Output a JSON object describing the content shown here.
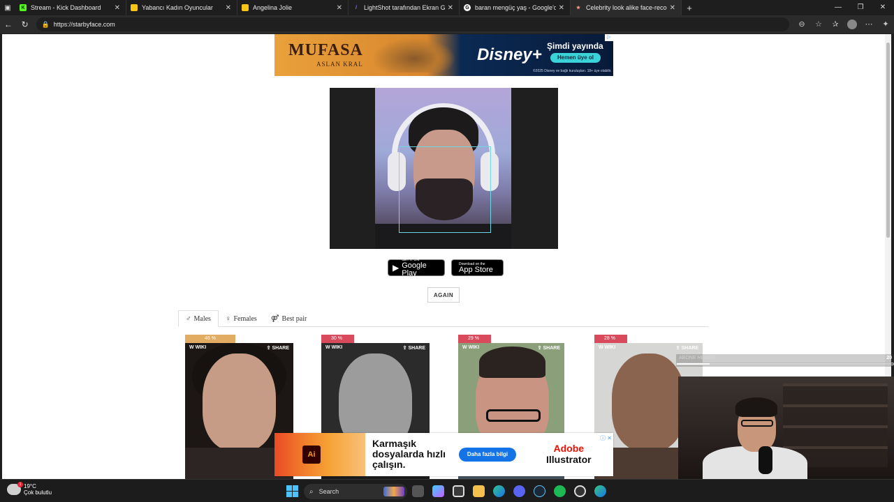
{
  "browser": {
    "tabs": [
      {
        "title": "Stream - Kick Dashboard",
        "icon": "kick-icon",
        "color": "#53fc18",
        "glyph": "K"
      },
      {
        "title": "Yabancı Kadın Oyuncular",
        "icon": "imdb-icon",
        "color": "#f5c518",
        "glyph": ""
      },
      {
        "title": "Angelina Jolie",
        "icon": "imdb-icon",
        "color": "#f5c518",
        "glyph": ""
      },
      {
        "title": "LightShot tarafından Ekran Görün",
        "icon": "lightshot-icon",
        "color": "#9c7cf4",
        "glyph": "/"
      },
      {
        "title": "baran mengüç yaş - Google'da Ar",
        "icon": "google-icon",
        "color": "#ffffff",
        "glyph": "G"
      },
      {
        "title": "Celebrity look alike face-recognit",
        "icon": "star-icon",
        "color": "#ff9a8b",
        "glyph": "★"
      }
    ],
    "url": "https://starbyface.com"
  },
  "ads": {
    "top": {
      "title": "MUFASA",
      "subtitle": "ASLAN KRAL",
      "brand": "Disney+",
      "headline": "Şimdi yayında",
      "cta": "Hemen üye ol",
      "fine_print": "©2025 Disney ve bağlı kuruluşları. 18+ üye olabilir."
    },
    "bottom": {
      "headline": "Karmaşık dosyalarda hızlı çalışın.",
      "cta": "Daha fazla bilgi",
      "brand_line1": "Adobe",
      "brand_line2": "Illustrator",
      "logo_text": "Ai"
    }
  },
  "store_badges": {
    "google_small": "GET IT ON",
    "google_big": "Google Play",
    "apple_small": "Download on the",
    "apple_big": "App Store"
  },
  "again_label": "AGAIN",
  "result_tabs": [
    {
      "label": "Males",
      "symbol": "♂"
    },
    {
      "label": "Females",
      "symbol": "♀"
    },
    {
      "label": "Best pair",
      "symbol": "⚤"
    }
  ],
  "results": [
    {
      "percent": "46 %",
      "wiki": "WIKI",
      "share": "SHARE"
    },
    {
      "percent": "30 %",
      "wiki": "WIKI",
      "share": "SHARE"
    },
    {
      "percent": "29 %",
      "wiki": "WIKI",
      "share": "SHARE"
    },
    {
      "percent": "28 %",
      "wiki": "WIKI",
      "share": "SHARE"
    }
  ],
  "overlay": {
    "label": "ABONE HEDEFİ",
    "count": "20",
    "progress": 0.15
  },
  "taskbar": {
    "temperature": "19°C",
    "condition": "Çok bulutlu",
    "search_placeholder": "Search",
    "notification_count": "1"
  }
}
